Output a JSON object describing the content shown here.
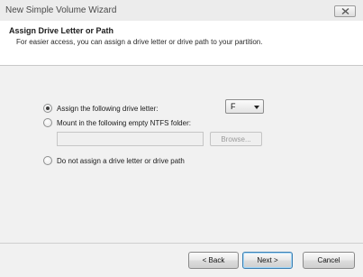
{
  "window": {
    "title": "New Simple Volume Wizard",
    "close_icon": "close-x-icon"
  },
  "header": {
    "title": "Assign Drive Letter or Path",
    "subtitle": "For easier access, you can assign a drive letter or drive path to your partition."
  },
  "options": [
    {
      "label": "Assign the following drive letter:",
      "selected": true
    },
    {
      "label": "Mount in the following empty NTFS folder:",
      "selected": false
    },
    {
      "label": "Do not assign a drive letter or drive path",
      "selected": false
    }
  ],
  "drive_letter": {
    "value": "F"
  },
  "folder_path": {
    "value": ""
  },
  "buttons": {
    "browse": "Browse...",
    "back": "< Back",
    "next": "Next >",
    "cancel": "Cancel"
  }
}
